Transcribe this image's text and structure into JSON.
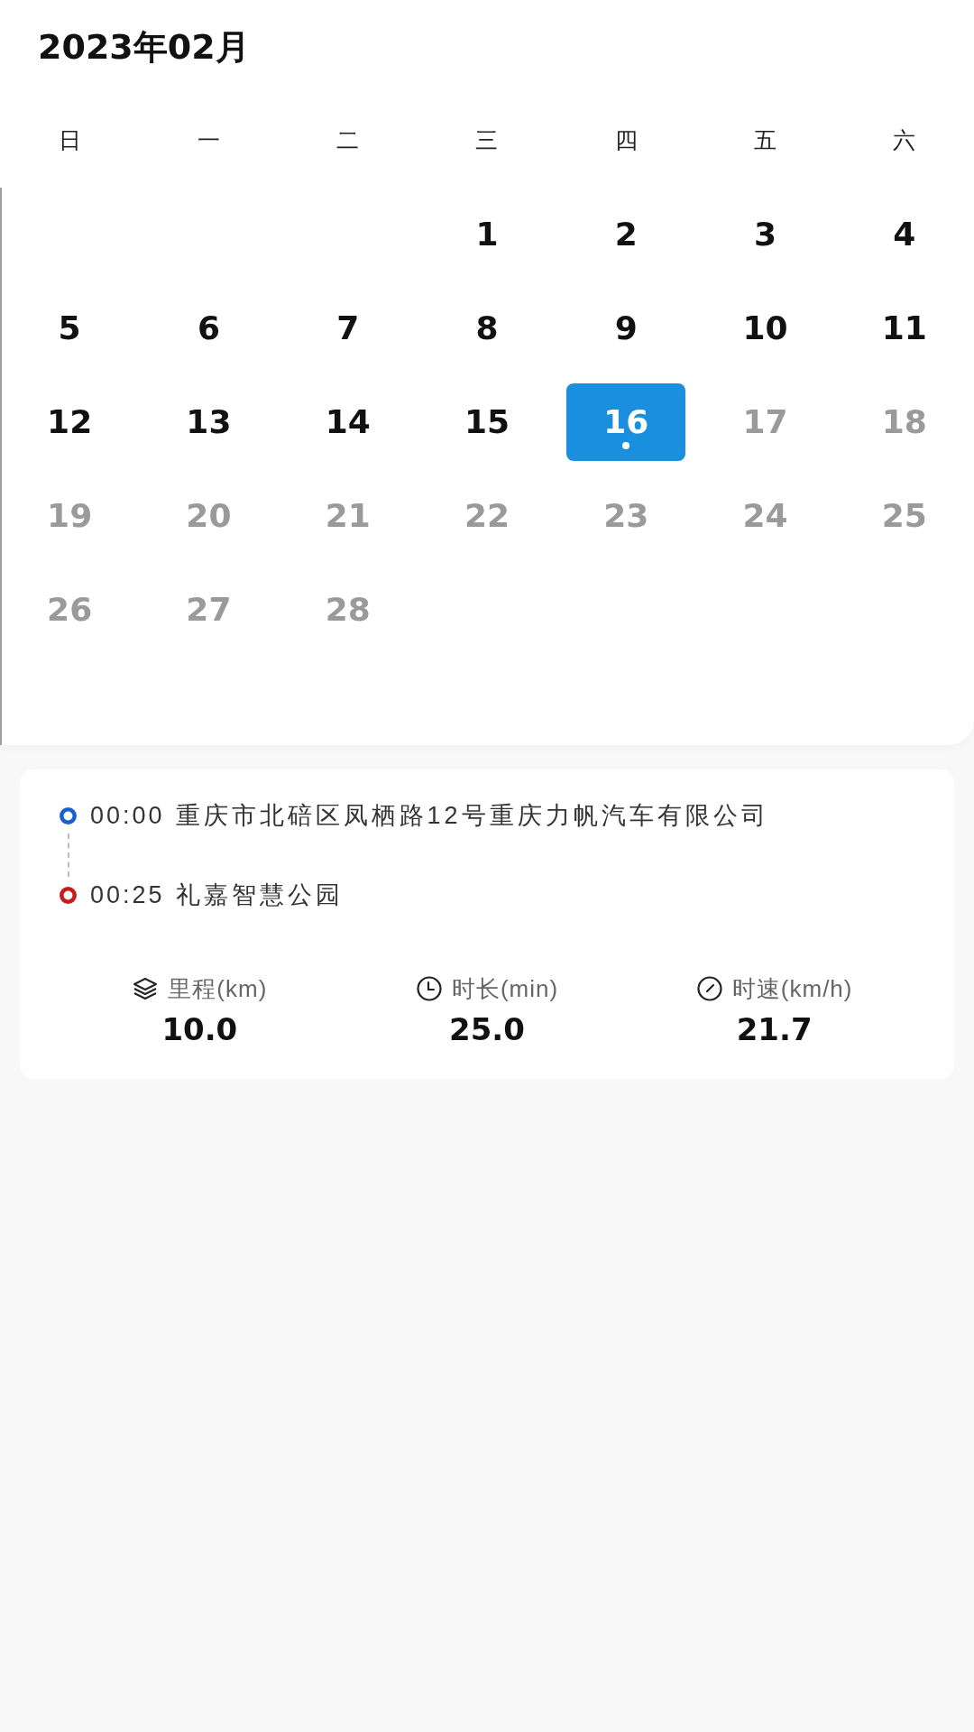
{
  "header": {
    "title": "2023年02月"
  },
  "calendar": {
    "weekdays": [
      "日",
      "一",
      "二",
      "三",
      "四",
      "五",
      "六"
    ],
    "weeks": [
      [
        {
          "day": "1",
          "selected": false,
          "dimmed": false,
          "dot": false
        },
        {
          "day": "2",
          "selected": false,
          "dimmed": false,
          "dot": false
        },
        {
          "day": "3",
          "selected": false,
          "dimmed": false,
          "dot": false
        },
        {
          "day": "4",
          "selected": false,
          "dimmed": false,
          "dot": false
        }
      ],
      [
        {
          "day": "5",
          "selected": false,
          "dimmed": false,
          "dot": false
        },
        {
          "day": "6",
          "selected": false,
          "dimmed": false,
          "dot": false
        },
        {
          "day": "7",
          "selected": false,
          "dimmed": false,
          "dot": false
        },
        {
          "day": "8",
          "selected": false,
          "dimmed": false,
          "dot": false
        },
        {
          "day": "9",
          "selected": false,
          "dimmed": false,
          "dot": false
        },
        {
          "day": "10",
          "selected": false,
          "dimmed": false,
          "dot": false
        },
        {
          "day": "11",
          "selected": false,
          "dimmed": false,
          "dot": false
        }
      ],
      [
        {
          "day": "12",
          "selected": false,
          "dimmed": false,
          "dot": false
        },
        {
          "day": "13",
          "selected": false,
          "dimmed": false,
          "dot": false
        },
        {
          "day": "14",
          "selected": false,
          "dimmed": false,
          "dot": false
        },
        {
          "day": "15",
          "selected": false,
          "dimmed": false,
          "dot": false
        },
        {
          "day": "16",
          "selected": true,
          "dimmed": false,
          "dot": true
        },
        {
          "day": "17",
          "selected": false,
          "dimmed": true,
          "dot": false
        },
        {
          "day": "18",
          "selected": false,
          "dimmed": true,
          "dot": false
        }
      ],
      [
        {
          "day": "19",
          "selected": false,
          "dimmed": true,
          "dot": false
        },
        {
          "day": "20",
          "selected": false,
          "dimmed": true,
          "dot": false
        },
        {
          "day": "21",
          "selected": false,
          "dimmed": true,
          "dot": false
        },
        {
          "day": "22",
          "selected": false,
          "dimmed": true,
          "dot": false
        },
        {
          "day": "23",
          "selected": false,
          "dimmed": true,
          "dot": false
        },
        {
          "day": "24",
          "selected": false,
          "dimmed": true,
          "dot": false
        },
        {
          "day": "25",
          "selected": false,
          "dimmed": true,
          "dot": false
        }
      ],
      [
        {
          "day": "26",
          "selected": false,
          "dimmed": true,
          "dot": false
        },
        {
          "day": "27",
          "selected": false,
          "dimmed": true,
          "dot": false
        },
        {
          "day": "28",
          "selected": false,
          "dimmed": true,
          "dot": false
        }
      ]
    ]
  },
  "trip": {
    "route": [
      {
        "color": "#1a5fd0",
        "time": "00:00",
        "place": "重庆市北碚区凤栖路12号重庆力帆汽车有限公司"
      },
      {
        "color": "#c81a1a",
        "time": "00:25",
        "place": "礼嘉智慧公园"
      }
    ],
    "stats": [
      {
        "kind": "distance",
        "label": "里程(km)",
        "value": "10.0"
      },
      {
        "kind": "duration",
        "label": "时长(min)",
        "value": "25.0"
      },
      {
        "kind": "speed",
        "label": "时速(km/h)",
        "value": "21.7"
      }
    ]
  }
}
